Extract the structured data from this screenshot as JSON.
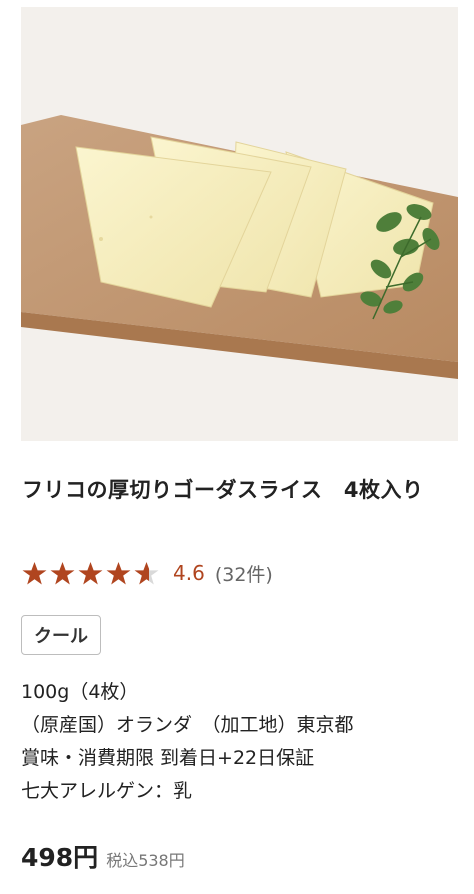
{
  "product": {
    "image_alt": "ゴーダチーズスライス",
    "title": "フリコの厚切りゴーダスライス　4枚入り",
    "rating": {
      "value": "4.6",
      "stars": 4.6,
      "max_stars": 5,
      "review_count": "(32件)",
      "star_color": "#b0451f"
    },
    "tag_label": "クール",
    "details": [
      "100g（4枚）",
      "（原産国）オランダ　（加工地）東京都",
      "賞味・消費期限 到着日+22日保証",
      "七大アレルゲン：乳"
    ],
    "price": "498円",
    "price_tax_included": "税込538円"
  }
}
